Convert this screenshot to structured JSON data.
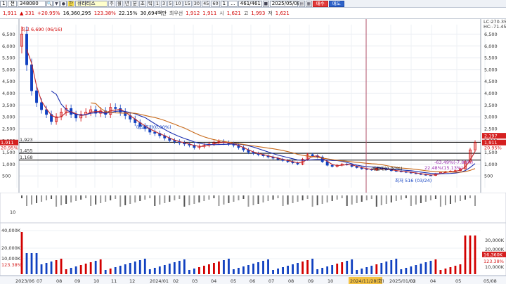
{
  "toolbar": {
    "slot_num": "1",
    "market": "전",
    "code": "348080",
    "market_badge": "한",
    "name": "큐라티스",
    "period_buttons": [
      "주",
      "월",
      "년",
      "분",
      "초",
      "틱"
    ],
    "minute_buttons": [
      "1",
      "3",
      "5",
      "10",
      "15",
      "30",
      "45",
      "60"
    ],
    "counter_a": "1",
    "counter_b": "...",
    "page": "461/461",
    "date": "2025/05/08",
    "buy_label": "매수",
    "sell_label": "매도"
  },
  "quote": {
    "price": "1,911",
    "change": "▲ 331",
    "change_pct": "+20.95%",
    "volume": "16,360,295",
    "volume_ratio": "123.38%",
    "turnover": "22.15%",
    "amount": "30,694백만",
    "priority_label": "최우선",
    "bid": "1,912",
    "ask": "1,911",
    "open_label": "시",
    "open": "1,621",
    "high_label": "고",
    "high": "1,993",
    "low_label": "저",
    "low": "1,621"
  },
  "price_axis": {
    "ticks": [
      "6,500",
      "6,000",
      "5,500",
      "5,000",
      "4,500",
      "4,000",
      "3,500",
      "3,000",
      "2,500",
      "2,000",
      "1,500",
      "1,000",
      "500"
    ],
    "top_right": [
      "LC:270.35",
      "HC:-71.45"
    ]
  },
  "levels": [
    {
      "label": "1,923",
      "value": 1923
    },
    {
      "label": "1,455",
      "value": 1455
    },
    {
      "label": "1,168",
      "value": 1168
    }
  ],
  "right_tags": [
    {
      "text": "2,197",
      "color": "#ffffff",
      "bg": "#d52020",
      "value": 2197
    },
    {
      "text": "1,911",
      "color": "#ffffff",
      "bg": "#d52020",
      "value": 1911
    },
    {
      "text": "20.95%",
      "color": "#d52020",
      "bg": "none",
      "value": 1700
    }
  ],
  "left_tags": [
    {
      "text": "1,911",
      "value": 1911
    },
    {
      "text": "20.95%",
      "value": 1700
    }
  ],
  "annotations": {
    "high": "최고 6,690 (06/16)",
    "low": "최저 516 (03/24)",
    "mid1": "매도호가(0.00%)",
    "mid2": "매물대(0.00%)",
    "pct1": "-63.49%(-7.89%)",
    "pct2": "22.48%(15.13%)",
    "x_marker": "2024/11/28(화)"
  },
  "volume_axis": {
    "ticks_left": [
      "40,000K",
      "20,000K",
      "10,000K"
    ],
    "ticks_right": [
      "30,000K",
      "20,000K",
      "10,000K"
    ],
    "tag_value": "16,360K",
    "tag_pct": "123.38%",
    "tag_pct2": "123.38%"
  },
  "indicator_axis": {
    "ticks": [
      "10"
    ]
  },
  "x_axis": {
    "labels": [
      "2023/06",
      "07",
      "08",
      "09",
      "10",
      "11",
      "12",
      "2024/01",
      "02",
      "03",
      "04",
      "05",
      "06",
      "07",
      "08",
      "09",
      "10",
      "2024/11/28(화)",
      "2025/01/02",
      "03",
      "04",
      "05",
      "05/08"
    ]
  },
  "colors": {
    "up": "#d20000",
    "down": "#1040c0",
    "ma5": "#c0282c",
    "ma20": "#1a2fb0",
    "ma60": "#c86a1a",
    "marker_line": "#b0506a"
  },
  "chart_data": {
    "type": "candlestick",
    "title": "",
    "y_range": [
      0,
      6900
    ],
    "closes": [
      6500,
      5200,
      4100,
      3600,
      3300,
      3100,
      2800,
      3000,
      3200,
      3350,
      3100,
      2950,
      3100,
      3200,
      3300,
      3150,
      3250,
      3100,
      3400,
      3350,
      3200,
      3050,
      2900,
      2750,
      2600,
      2500,
      2350,
      2300,
      2200,
      2100,
      2000,
      1950,
      1900,
      1850,
      1800,
      1700,
      1750,
      1800,
      1850,
      1900,
      1950,
      1900,
      1850,
      1800,
      1700,
      1600,
      1500,
      1450,
      1400,
      1350,
      1300,
      1250,
      1200,
      1150,
      1100,
      1050,
      1000,
      1200,
      1400,
      1350,
      1300,
      1100,
      950,
      900,
      950,
      1000,
      980,
      900,
      850,
      800,
      780,
      750,
      820,
      800,
      760,
      720,
      700,
      680,
      650,
      620,
      600,
      560,
      530,
      520,
      600,
      650,
      680,
      700,
      720,
      800,
      1100,
      1600,
      1911
    ],
    "ma5_note": "moving average overlays",
    "levels": [
      1923,
      1455,
      1168
    ]
  }
}
